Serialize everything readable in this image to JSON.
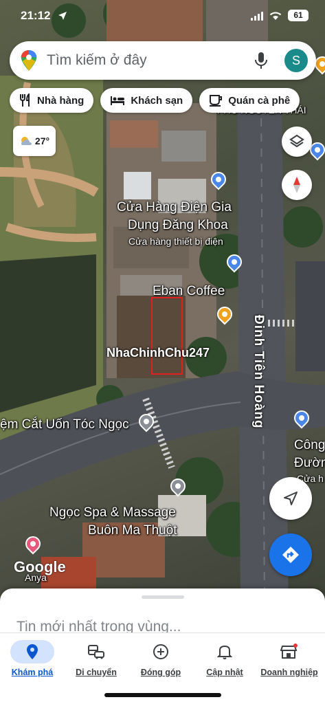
{
  "status_bar": {
    "time": "21:12",
    "battery": "61"
  },
  "search": {
    "placeholder": "Tìm kiếm ở đây",
    "avatar_letter": "S"
  },
  "chips": [
    {
      "label": "Nhà hàng",
      "icon": "restaurant-icon"
    },
    {
      "label": "Khách sạn",
      "icon": "hotel-icon"
    },
    {
      "label": "Quán cà phê",
      "icon": "coffee-icon"
    }
  ],
  "weather": {
    "temperature": "27°",
    "icon": "partly-cloudy-icon"
  },
  "map": {
    "labels": {
      "street_top": "PHỐ NGUYỄN THÁI",
      "store_name_1": "Cửa Hàng Điện Gia",
      "store_name_2": "Dụng Đăng Khoa",
      "store_category": "Cửa hàng thiết bị điện",
      "coffee": "Eban Coffee",
      "street_main": "Đinh Tiên Hoàng",
      "hair_salon": "ệm Cắt Uốn Tóc Ngọc",
      "spa_1": "Ngọc Spa & Massage",
      "spa_2": "Buôn Ma Thuột",
      "edge_1": "Công",
      "edge_2": "Đườn",
      "edge_3": "Cửa h",
      "bottom_left": "Anya",
      "logo": "Google"
    },
    "watermark": "NhaChinhChu247",
    "colors": {
      "pin_blue": "#4a87e8",
      "pin_orange": "#f0a11e",
      "highlight": "#e02020"
    }
  },
  "sheet": {
    "title": "Tin mới nhất trong vùng..."
  },
  "nav": [
    {
      "label": "Khám phá",
      "icon": "explore-pin-icon",
      "active": true
    },
    {
      "label": "Di chuyển",
      "icon": "commute-icon",
      "active": false
    },
    {
      "label": "Đóng góp",
      "icon": "add-circle-icon",
      "active": false
    },
    {
      "label": "Cập nhật",
      "icon": "bell-icon",
      "active": false
    },
    {
      "label": "Doanh nghiệp",
      "icon": "storefront-icon",
      "active": false
    }
  ]
}
